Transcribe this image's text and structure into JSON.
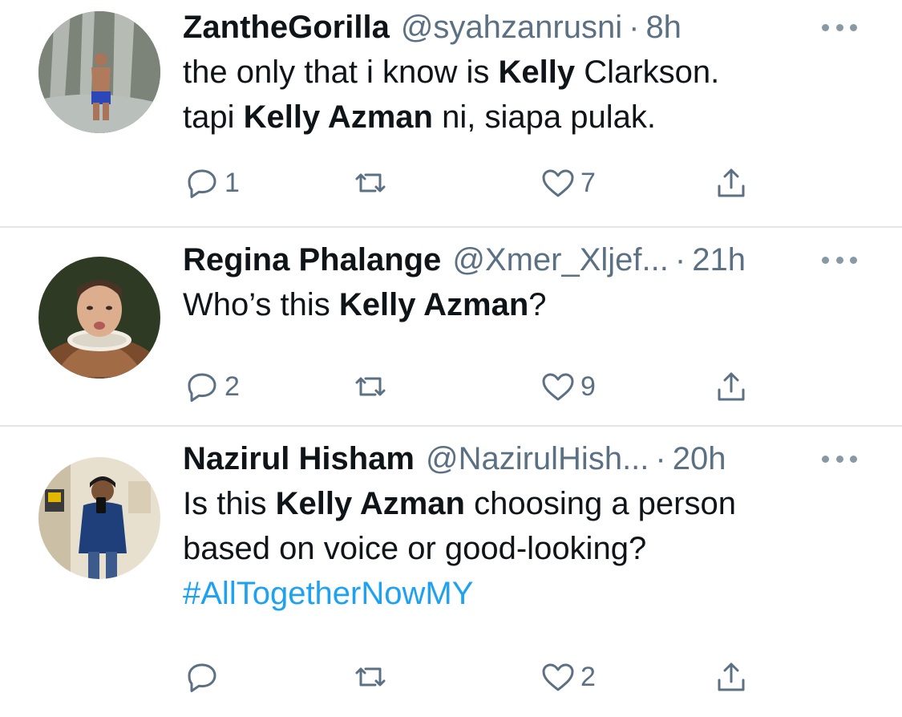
{
  "tweets": [
    {
      "display_name": "ZantheGorilla",
      "handle": "@syahzanrusni",
      "separator": "·",
      "time": "8h",
      "text_parts": [
        {
          "t": "the only that i know is ",
          "bold": false
        },
        {
          "t": "Kelly",
          "bold": true
        },
        {
          "t": " Clarkson.",
          "bold": false
        },
        {
          "br": true
        },
        {
          "t": "tapi ",
          "bold": false
        },
        {
          "t": "Kelly Azman",
          "bold": true
        },
        {
          "t": " ni, siapa pulak.",
          "bold": false
        }
      ],
      "avatar_icon": "avatar-waterfall-photo",
      "reply_count": "1",
      "like_count": "7"
    },
    {
      "display_name": "Regina Phalange",
      "handle": "@Xmer_Xljef...",
      "separator": "·",
      "time": "21h",
      "text_parts": [
        {
          "t": "Who’s this ",
          "bold": false
        },
        {
          "t": "Kelly Azman",
          "bold": true
        },
        {
          "t": "?",
          "bold": false
        }
      ],
      "avatar_icon": "avatar-painting-portrait",
      "reply_count": "2",
      "like_count": "9"
    },
    {
      "display_name": "Nazirul Hisham",
      "handle": "@NazirulHish...",
      "separator": "·",
      "time": "20h",
      "text_parts": [
        {
          "t": "Is this ",
          "bold": false
        },
        {
          "t": "Kelly Azman",
          "bold": true
        },
        {
          "t": " choosing a person",
          "bold": false
        },
        {
          "br": true
        },
        {
          "t": "based on voice or good-looking?",
          "bold": false
        },
        {
          "br": true
        },
        {
          "t": "#AllTogetherNowMY",
          "hashtag": true
        }
      ],
      "avatar_icon": "avatar-mirror-selfie",
      "reply_count": "",
      "like_count": "2"
    }
  ],
  "colors": {
    "text": "#0f1419",
    "secondary": "#5b7083",
    "hashtag": "#1da1f2",
    "divider": "#e3e6e9"
  },
  "icons": [
    "reply-icon",
    "retweet-icon",
    "like-icon",
    "share-icon",
    "more-icon"
  ]
}
